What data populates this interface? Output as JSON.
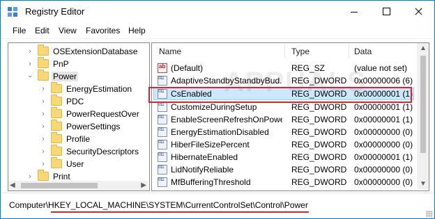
{
  "window": {
    "title": "Registry Editor"
  },
  "menu": [
    "File",
    "Edit",
    "View",
    "Favorites",
    "Help"
  ],
  "tree": {
    "items": [
      {
        "label": "OSExtensionDatabase",
        "expanded": false
      },
      {
        "label": "PnP",
        "expanded": false
      },
      {
        "label": "Power",
        "expanded": true,
        "selected": true
      },
      {
        "label": "EnergyEstimation",
        "expanded": false
      },
      {
        "label": "PDC",
        "expanded": false
      },
      {
        "label": "PowerRequestOver",
        "expanded": false
      },
      {
        "label": "PowerSettings",
        "expanded": false
      },
      {
        "label": "Profile",
        "expanded": false
      },
      {
        "label": "SecurityDescriptors",
        "expanded": false
      },
      {
        "label": "User",
        "expanded": false
      },
      {
        "label": "Print",
        "expanded": false
      }
    ]
  },
  "list": {
    "headers": {
      "name": "Name",
      "type": "Type",
      "data": "Data"
    },
    "rows": [
      {
        "name": "(Default)",
        "type": "REG_SZ",
        "data": "(value not set)",
        "icon": "string-value-icon"
      },
      {
        "name": "AdaptiveStandbyStandbyBud...",
        "type": "REG_DWORD",
        "data": "0x00000006 (6)",
        "icon": "dword-value-icon"
      },
      {
        "name": "CsEnabled",
        "type": "REG_DWORD",
        "data": "0x00000001 (1)",
        "icon": "dword-value-icon",
        "selected": true
      },
      {
        "name": "CustomizeDuringSetup",
        "type": "REG_DWORD",
        "data": "0x00000001 (1)",
        "icon": "dword-value-icon"
      },
      {
        "name": "EnableScreenRefreshOnPowe...",
        "type": "REG_DWORD",
        "data": "0x00000001 (1)",
        "icon": "dword-value-icon"
      },
      {
        "name": "EnergyEstimationDisabled",
        "type": "REG_DWORD",
        "data": "0x00000000 (0)",
        "icon": "dword-value-icon"
      },
      {
        "name": "HiberFileSizePercent",
        "type": "REG_DWORD",
        "data": "0x00000000 (0)",
        "icon": "dword-value-icon"
      },
      {
        "name": "HibernateEnabled",
        "type": "REG_DWORD",
        "data": "0x00000001 (1)",
        "icon": "dword-value-icon"
      },
      {
        "name": "LidNotifyReliable",
        "type": "REG_DWORD",
        "data": "0x00000000 (0)",
        "icon": "dword-value-icon"
      },
      {
        "name": "MfBufferingThreshold",
        "type": "REG_DWORD",
        "data": "0x00000000 (0)",
        "icon": "dword-value-icon"
      }
    ]
  },
  "status": {
    "path": "Computer\\HKEY_LOCAL_MACHINE\\SYSTEM\\CurrentControlSet\\Control\\Power"
  },
  "watermark": "APPUALS",
  "colors": {
    "accent": "#0078d7",
    "annotation": "#d9262a",
    "selection": "#cce8ff",
    "folder": "#f8d775"
  }
}
